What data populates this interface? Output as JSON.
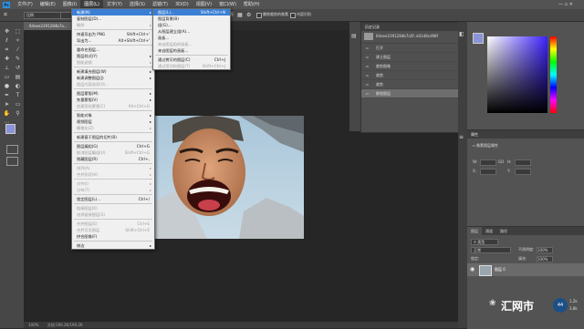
{
  "menubar": {
    "logo": "Ps",
    "items": [
      "文件(F)",
      "编辑(E)",
      "图像(I)",
      "图层(L)",
      "文字(Y)",
      "选择(S)",
      "滤镜(T)",
      "3D(D)",
      "视图(V)",
      "窗口(W)",
      "帮助(H)"
    ]
  },
  "options": {
    "mode": "比例",
    "clear": "清除",
    "field_a": "拉直",
    "delete_label": "删除裁剪的像素",
    "content_label": "内容识别"
  },
  "document": {
    "tab": "64eee2391284b7a...",
    "zoom": "100%",
    "doc_info": "文档:190.2K/190.2K"
  },
  "layer_menu": {
    "items": [
      {
        "label": "新建(N)",
        "sc": "",
        "arrow": true,
        "state": "highlight"
      },
      {
        "label": "复制图层(D)...",
        "sc": "",
        "arrow": false,
        "state": "normal"
      },
      {
        "label": "删除",
        "sc": "",
        "arrow": true,
        "state": "disabled"
      },
      {
        "sep": true
      },
      {
        "label": "快速导出为 PNG",
        "sc": "Shift+Ctrl+'",
        "arrow": false,
        "state": "normal"
      },
      {
        "label": "导出为...",
        "sc": "Alt+Shift+Ctrl+'",
        "arrow": false,
        "state": "normal"
      },
      {
        "sep": true
      },
      {
        "label": "重命名图层...",
        "sc": "",
        "arrow": false,
        "state": "normal"
      },
      {
        "label": "图层样式(Y)",
        "sc": "",
        "arrow": true,
        "state": "normal"
      },
      {
        "label": "智能滤镜",
        "sc": "",
        "arrow": true,
        "state": "disabled"
      },
      {
        "sep": true
      },
      {
        "label": "新建填充图层(W)",
        "sc": "",
        "arrow": true,
        "state": "normal"
      },
      {
        "label": "新建调整图层(J)",
        "sc": "",
        "arrow": true,
        "state": "normal"
      },
      {
        "label": "图层内容选项(O)...",
        "sc": "",
        "arrow": false,
        "state": "disabled"
      },
      {
        "sep": true
      },
      {
        "label": "图层蒙版(M)",
        "sc": "",
        "arrow": true,
        "state": "normal"
      },
      {
        "label": "矢量蒙版(V)",
        "sc": "",
        "arrow": true,
        "state": "normal"
      },
      {
        "label": "创建剪贴蒙版(C)",
        "sc": "Alt+Ctrl+G",
        "arrow": false,
        "state": "disabled"
      },
      {
        "sep": true
      },
      {
        "label": "智能对象",
        "sc": "",
        "arrow": true,
        "state": "normal"
      },
      {
        "label": "视频图层",
        "sc": "",
        "arrow": true,
        "state": "normal"
      },
      {
        "label": "栅格化(Z)",
        "sc": "",
        "arrow": true,
        "state": "disabled"
      },
      {
        "sep": true
      },
      {
        "label": "新建基于图层的切片(B)",
        "sc": "",
        "arrow": false,
        "state": "normal"
      },
      {
        "sep": true
      },
      {
        "label": "图层编组(G)",
        "sc": "Ctrl+G",
        "arrow": false,
        "state": "normal"
      },
      {
        "label": "取消图层编组(U)",
        "sc": "Shift+Ctrl+G",
        "arrow": false,
        "state": "disabled"
      },
      {
        "label": "隐藏图层(R)",
        "sc": "Ctrl+,",
        "arrow": false,
        "state": "normal"
      },
      {
        "sep": true
      },
      {
        "label": "排列(A)",
        "sc": "",
        "arrow": true,
        "state": "disabled"
      },
      {
        "label": "合并形状(H)",
        "sc": "",
        "arrow": true,
        "state": "disabled"
      },
      {
        "sep": true
      },
      {
        "label": "对齐(I)",
        "sc": "",
        "arrow": true,
        "state": "disabled"
      },
      {
        "label": "分布(T)",
        "sc": "",
        "arrow": true,
        "state": "disabled"
      },
      {
        "sep": true
      },
      {
        "label": "锁定图层(L)...",
        "sc": "Ctrl+/",
        "arrow": false,
        "state": "normal"
      },
      {
        "sep": true
      },
      {
        "label": "链接图层(K)",
        "sc": "",
        "arrow": false,
        "state": "disabled"
      },
      {
        "label": "选择链接图层(S)",
        "sc": "",
        "arrow": false,
        "state": "disabled"
      },
      {
        "sep": true
      },
      {
        "label": "合并图层(E)",
        "sc": "Ctrl+E",
        "arrow": false,
        "state": "disabled"
      },
      {
        "label": "合并可见图层",
        "sc": "Shift+Ctrl+E",
        "arrow": false,
        "state": "disabled"
      },
      {
        "label": "拼合图像(F)",
        "sc": "",
        "arrow": false,
        "state": "normal"
      },
      {
        "sep": true
      },
      {
        "label": "修边",
        "sc": "",
        "arrow": true,
        "state": "normal"
      }
    ]
  },
  "new_submenu": {
    "items": [
      {
        "label": "图层(L)...",
        "sc": "Shift+Ctrl+N",
        "state": "highlight"
      },
      {
        "label": "图层背景(B)",
        "sc": "",
        "state": "normal"
      },
      {
        "label": "组(G)...",
        "sc": "",
        "state": "normal"
      },
      {
        "label": "从图层建立组(A)...",
        "sc": "",
        "state": "normal"
      },
      {
        "label": "画板...",
        "sc": "",
        "state": "normal"
      },
      {
        "label": "来自图层组的画板...",
        "sc": "",
        "state": "disabled"
      },
      {
        "label": "来自图层的画板...",
        "sc": "",
        "state": "normal"
      },
      {
        "sep": true
      },
      {
        "label": "通过拷贝的图层(C)",
        "sc": "Ctrl+J",
        "state": "normal"
      },
      {
        "label": "通过剪切的图层(T)",
        "sc": "Shift+Ctrl+J",
        "state": "disabled"
      }
    ]
  },
  "history": {
    "tabs": [
      "历史记录"
    ],
    "snapshot": "64eee2391284b7a5f..d41d8cd98f",
    "items": [
      "打开",
      "建立图层",
      "裁剪图像",
      "裁剪",
      "裁剪",
      "解锁图层"
    ]
  },
  "properties": {
    "title": "属性",
    "subtitle": "像素图层属性",
    "w": "W:",
    "h": "H:",
    "x": "X:",
    "y": "Y:",
    "go": "GO"
  },
  "layers": {
    "tabs": [
      "图层",
      "通道",
      "路径"
    ],
    "filter": "类型",
    "blend": "正常",
    "opacity_label": "不透明度:",
    "opacity": "100%",
    "lock_label": "锁定:",
    "fill_label": "填充:",
    "fill": "100%",
    "layer_name": "图层 0"
  },
  "watermark": {
    "text": "汇网市",
    "badge": "44",
    "k1": "1.2k",
    "k2": "3.8k"
  },
  "colors": {
    "accent": "#3a7fd4",
    "foreground": "#8a94d8",
    "background": "#f3b6c0"
  }
}
